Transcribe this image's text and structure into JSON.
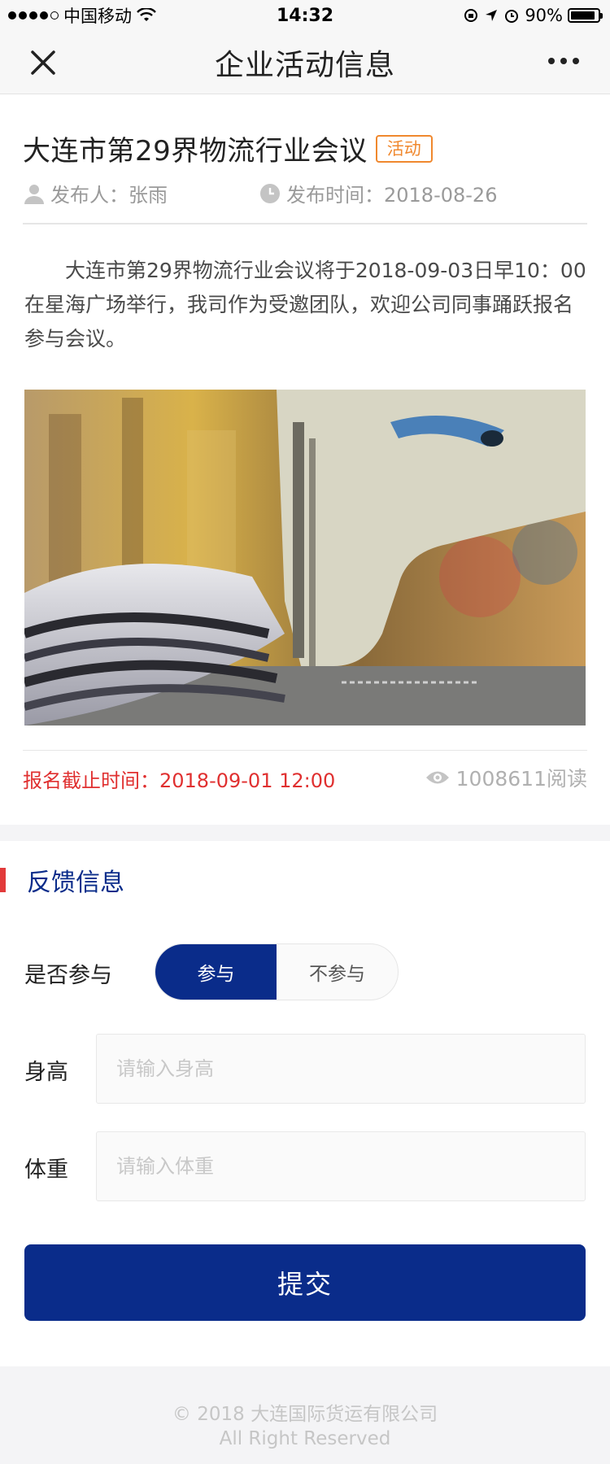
{
  "status_bar": {
    "carrier": "中国移动",
    "time": "14:32",
    "battery": "90%",
    "battery_level": 0.9
  },
  "nav": {
    "title": "企业活动信息"
  },
  "article": {
    "title": "大连市第29界物流行业会议",
    "tag": "活动",
    "author_label": "发布人：张雨",
    "time_label": "发布时间：2018-08-26",
    "body": "大连市第29界物流行业会议将于2018-09-03日早10：00在星海广场举行，我司作为受邀团队，欢迎公司同事踊跃报名参与会议。",
    "deadline": "报名截止时间：2018-09-01 12:00",
    "reads": "1008611阅读"
  },
  "feedback": {
    "section_title": "反馈信息",
    "participate_label": "是否参与",
    "option_yes": "参与",
    "option_no": "不参与",
    "height_label": "身高",
    "height_placeholder": "请输入身高",
    "weight_label": "体重",
    "weight_placeholder": "请输入体重",
    "submit_label": "提交"
  },
  "footer": {
    "line1": "© 2018 大连国际货运有限公司",
    "line2": "All Right Reserved"
  },
  "colors": {
    "brand": "#0a2c8a",
    "accent_red": "#e03030",
    "tag_orange": "#f0882e"
  }
}
